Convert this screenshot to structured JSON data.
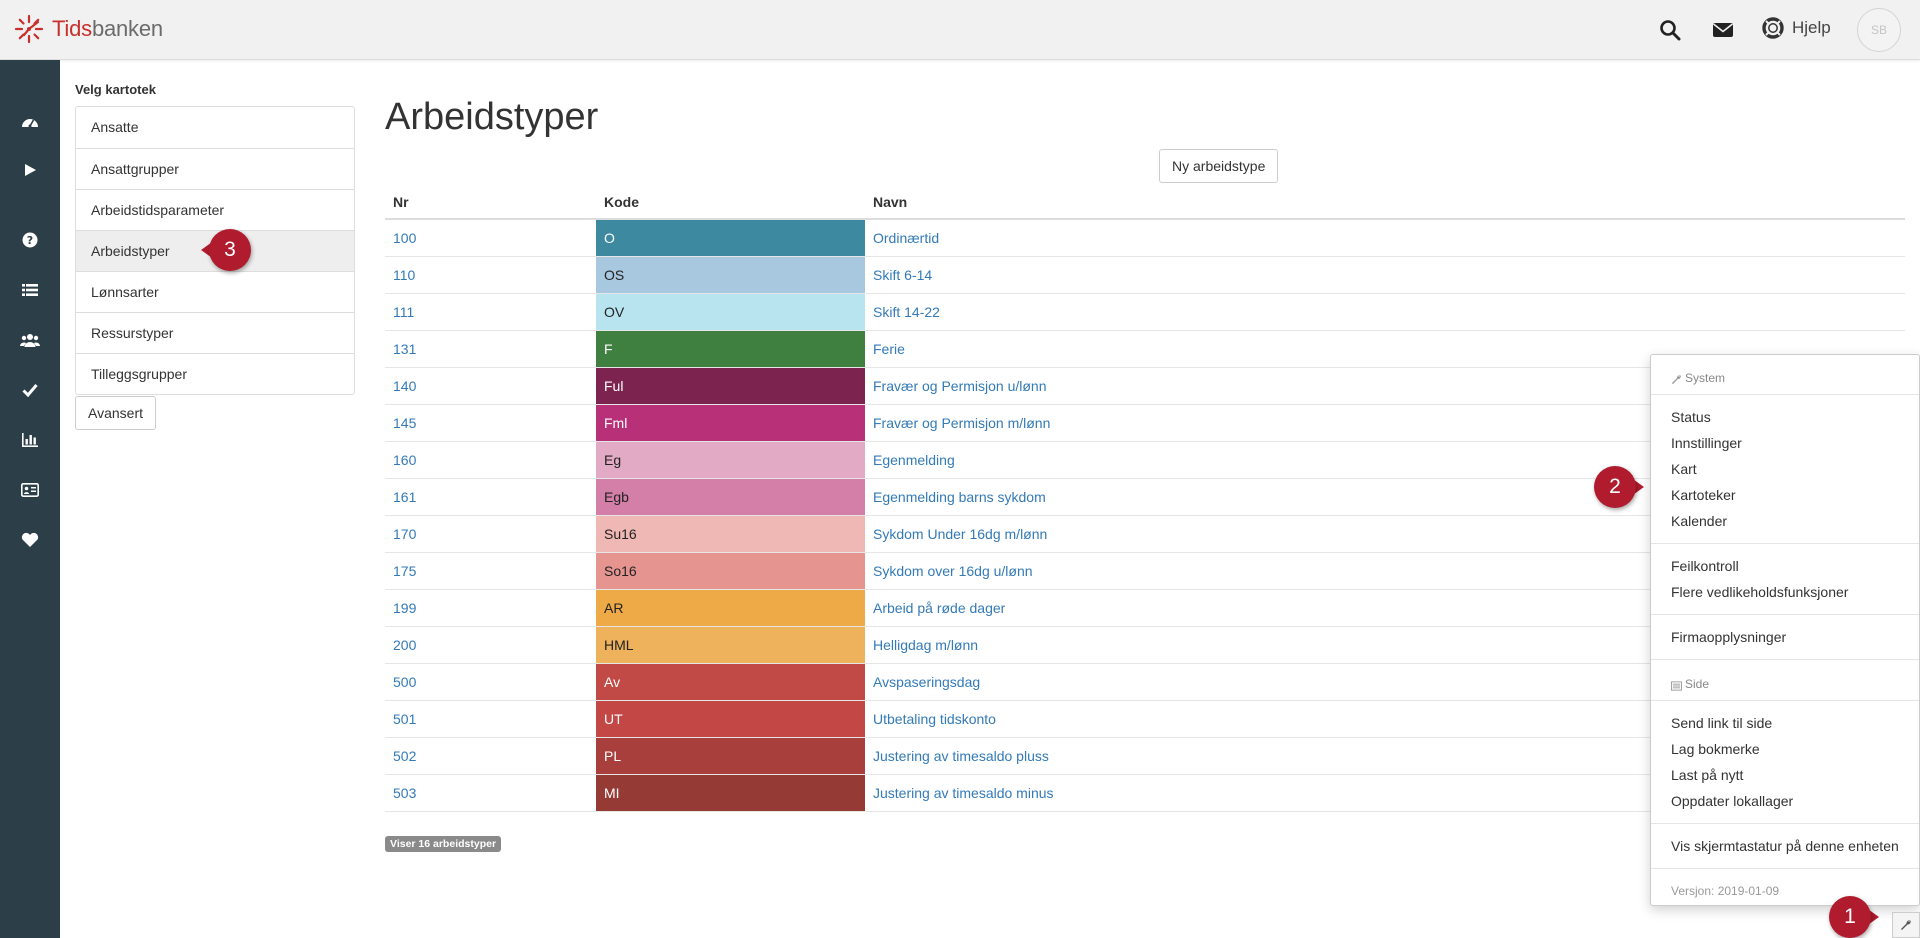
{
  "app": {
    "logo_part1": "Tids",
    "logo_part2": "banken",
    "help_label": "Hjelp",
    "avatar_initials": "SB"
  },
  "rail_icons": [
    "dashboard-icon",
    "play-icon",
    "question-icon",
    "list-icon",
    "users-icon",
    "check-icon",
    "bar-chart-icon",
    "id-card-icon",
    "heart-icon"
  ],
  "kartotek": {
    "title": "Velg kartotek",
    "items": [
      "Ansatte",
      "Ansattgrupper",
      "Arbeidstidsparameter",
      "Arbeidstyper",
      "Lønnsarter",
      "Ressurstyper",
      "Tilleggsgrupper"
    ],
    "active_index": 3,
    "advanced_label": "Avansert"
  },
  "main": {
    "title": "Arbeidstyper",
    "new_button": "Ny arbeidstype",
    "columns": {
      "nr": "Nr",
      "kode": "Kode",
      "navn": "Navn"
    },
    "rows": [
      {
        "nr": "100",
        "kode": "O",
        "navn": "Ordinærtid",
        "color": "#3d8aa0",
        "text_color": "#ffffff"
      },
      {
        "nr": "110",
        "kode": "OS",
        "navn": "Skift 6-14",
        "color": "#a8c8e0",
        "text_color": "#222222"
      },
      {
        "nr": "111",
        "kode": "OV",
        "navn": "Skift 14-22",
        "color": "#b8e4f0",
        "text_color": "#222222"
      },
      {
        "nr": "131",
        "kode": "F",
        "navn": "Ferie",
        "color": "#3f7f3f",
        "text_color": "#ffffff"
      },
      {
        "nr": "140",
        "kode": "Ful",
        "navn": "Fravær og Permisjon u/lønn",
        "color": "#7d2350",
        "text_color": "#ffffff"
      },
      {
        "nr": "145",
        "kode": "Fml",
        "navn": "Fravær og Permisjon m/lønn",
        "color": "#b73078",
        "text_color": "#ffffff"
      },
      {
        "nr": "160",
        "kode": "Eg",
        "navn": "Egenmelding",
        "color": "#e3aac6",
        "text_color": "#222222"
      },
      {
        "nr": "161",
        "kode": "Egb",
        "navn": "Egenmelding barns sykdom",
        "color": "#d37fa8",
        "text_color": "#222222"
      },
      {
        "nr": "170",
        "kode": "Su16",
        "navn": "Sykdom Under 16dg m/lønn",
        "color": "#efb8b4",
        "text_color": "#222222"
      },
      {
        "nr": "175",
        "kode": "So16",
        "navn": "Sykdom over 16dg u/lønn",
        "color": "#e69490",
        "text_color": "#222222"
      },
      {
        "nr": "199",
        "kode": "AR",
        "navn": "Arbeid på røde dager",
        "color": "#efaa48",
        "text_color": "#222222"
      },
      {
        "nr": "200",
        "kode": "HML",
        "navn": "Helligdag m/lønn",
        "color": "#efb25c",
        "text_color": "#222222"
      },
      {
        "nr": "500",
        "kode": "Av",
        "navn": "Avspaseringsdag",
        "color": "#c14a47",
        "text_color": "#ffffff"
      },
      {
        "nr": "501",
        "kode": "UT",
        "navn": "Utbetaling tidskonto",
        "color": "#c34744",
        "text_color": "#ffffff"
      },
      {
        "nr": "502",
        "kode": "PL",
        "navn": "Justering av timesaldo pluss",
        "color": "#a93f3c",
        "text_color": "#ffffff"
      },
      {
        "nr": "503",
        "kode": "MI",
        "navn": "Justering av timesaldo minus",
        "color": "#963a36",
        "text_color": "#ffffff"
      }
    ],
    "count_label": "Viser 16 arbeidstyper"
  },
  "system_menu": {
    "system_header": "System",
    "group1": [
      "Status",
      "Innstillinger",
      "Kart",
      "Kartoteker",
      "Kalender"
    ],
    "group2": [
      "Feilkontroll",
      "Flere vedlikeholdsfunksjoner"
    ],
    "group3": [
      "Firmaopplysninger"
    ],
    "side_header": "Side",
    "group4": [
      "Send link til side",
      "Lag bokmerke",
      "Last på nytt",
      "Oppdater lokallager"
    ],
    "group5": [
      "Vis skjermtastatur på denne enheten"
    ],
    "version": "Versjon: 2019-01-09"
  },
  "callouts": {
    "one": "1",
    "two": "2",
    "three": "3"
  },
  "colors": {
    "rail": "#2c3e48",
    "brand_red": "#c9302c",
    "link": "#337ab7",
    "callout": "#b01c2e"
  }
}
